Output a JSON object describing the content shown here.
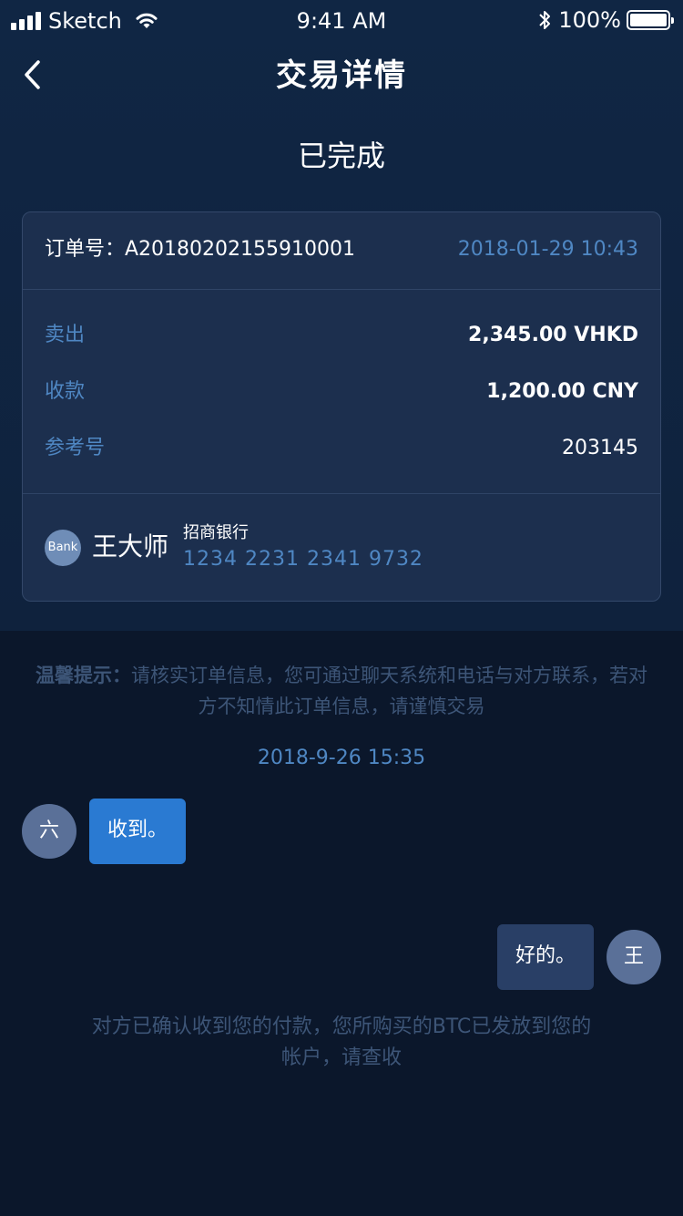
{
  "status_bar": {
    "carrier": "Sketch",
    "time": "9:41 AM",
    "battery": "100%",
    "icons": [
      "signal-icon",
      "wifi-icon",
      "bluetooth-icon",
      "battery-icon"
    ]
  },
  "nav": {
    "title": "交易详情",
    "back_icon": "chevron-left-icon"
  },
  "order_state": "已完成",
  "card": {
    "order_label": "订单号：A20180202155910001",
    "order_date": "2018-01-29 10:43",
    "rows": [
      {
        "label": "卖出",
        "value": "2,345.00 VHKD"
      },
      {
        "label": "收款",
        "value": "1,200.00 CNY"
      },
      {
        "label": "参考号",
        "value": "203145"
      }
    ],
    "bank_badge": "Bank",
    "payee": "王大师",
    "bank_name": "招商银行",
    "bank_account": "1234 2231 2341 9732"
  },
  "tip": {
    "prefix": "温馨提示：",
    "text": "请核实订单信息，您可通过聊天系统和电话与对方联系，若对方不知情此订单信息，请谨慎交易"
  },
  "chat": {
    "time": "2018-9-26 15:35",
    "messages": [
      {
        "avatar": "六",
        "text": "收到。"
      },
      {
        "avatar": "王",
        "text": "好的。"
      }
    ]
  },
  "confirmation": "对方已确认收到您的付款，您所购买的BTC已发放到您的帐户，请查收",
  "colors": {
    "background": "#0b172b",
    "card": "#1c2f4e",
    "accent": "#4f87c3",
    "incoming_bubble": "#2a7ad2",
    "outgoing_bubble": "#293f66"
  }
}
